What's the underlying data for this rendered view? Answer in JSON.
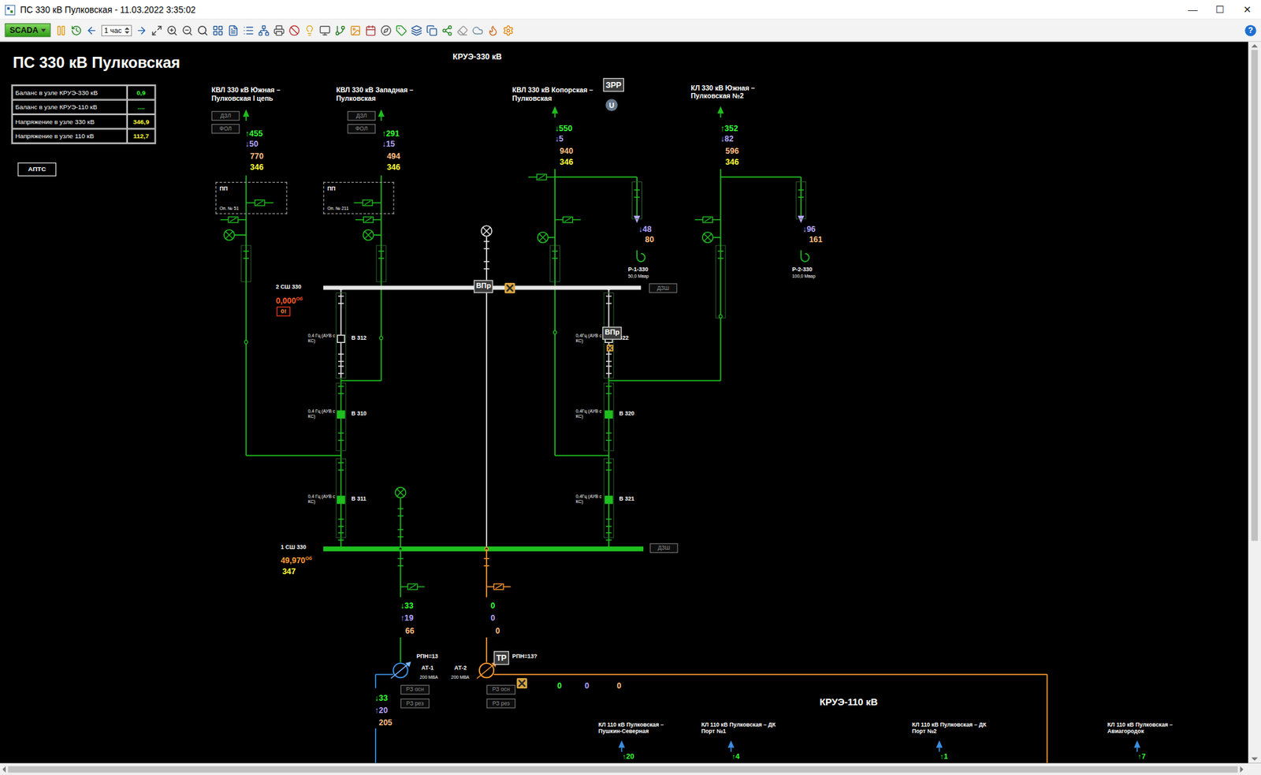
{
  "window": {
    "title": "ПС 330 кВ Пулковская - 11.03.2022 3:35:02",
    "controls": [
      "—",
      "☐",
      "✕"
    ]
  },
  "toolbar": {
    "mode": "SCADA",
    "interval": "1 час",
    "help": "?"
  },
  "header": {
    "title": "ПС 330 кВ Пулковская",
    "section_330": "КРУЭ-330 кВ",
    "section_110": "КРУЭ-110 кВ"
  },
  "info_table": [
    {
      "label": "Баланс в узле КРУЭ-330 кВ",
      "value": "0,9",
      "color": "#33ff33"
    },
    {
      "label": "Баланс в узле КРУЭ-110 кВ",
      "value": "....",
      "color": "#33ff33"
    },
    {
      "label": "Напряжение в узле 330 кВ",
      "value": "346,9",
      "color": "#ffff33"
    },
    {
      "label": "Напряжение в узле 110 кВ",
      "value": "112,7",
      "color": "#ffff33"
    }
  ],
  "aptc_button": "АПТС",
  "feeders_330": [
    {
      "name": "КВЛ 330 кВ Южная – Пулковская I цепь",
      "badges": [
        {
          "label": "ДЗЛ",
          "disabled": true
        },
        {
          "label": "ФОЛ",
          "disabled": true
        }
      ],
      "tags": [],
      "p": "↑455",
      "q": "↓50",
      "i": "770",
      "u": "346",
      "pp": {
        "label": "ПП",
        "support": "Оп. № 51"
      }
    },
    {
      "name": "КВЛ 330 кВ Западная – Пулковская",
      "badges": [
        {
          "label": "ДЗЛ",
          "disabled": true
        },
        {
          "label": "ФОЛ",
          "disabled": true
        }
      ],
      "tags": [],
      "p": "↑291",
      "q": "↓15",
      "i": "494",
      "u": "346",
      "pp": {
        "label": "ПП",
        "support": "Оп. № 211"
      }
    },
    {
      "name": "КВЛ 330 кВ Копорская – Пулковская",
      "badges": [],
      "tags": [
        {
          "label": "ЗРР",
          "kind": "box"
        },
        {
          "label": "U",
          "kind": "circle"
        }
      ],
      "p": "↓550",
      "q": "↓5",
      "i": "940",
      "u": "346",
      "reactor": {
        "q": "↓48",
        "i": "80",
        "name": "Р-1-330",
        "rating": "50,0 Мвар"
      }
    },
    {
      "name": "КЛ 330 кВ Южная – Пулковская №2",
      "badges": [],
      "tags": [],
      "p": "↑352",
      "q": "↓82",
      "i": "596",
      "u": "346",
      "reactor": {
        "q": "↓96",
        "i": "161",
        "name": "Р-2-330",
        "rating": "100,0 Мвар"
      }
    }
  ],
  "buses": [
    {
      "name": "2 СШ 330",
      "reading": "0,000",
      "unit": "Об",
      "alarm": "0!",
      "voltage": "",
      "energized": false,
      "protection": {
        "label": "ДЗШ",
        "disabled": true
      }
    },
    {
      "name": "1 СШ 330",
      "reading": "49,970",
      "unit": "Об",
      "alarm": "",
      "voltage": "347",
      "energized": true,
      "protection": {
        "label": "ДЗШ",
        "disabled": true
      }
    }
  ],
  "coupler": {
    "marker": "ВПр"
  },
  "breakers": [
    {
      "name": "В 312",
      "note": "0,4 Гц (АУВ с КС)",
      "closed": false,
      "marker": ""
    },
    {
      "name": "В 310",
      "note": "0,4 Гц (АУВ с КС)",
      "closed": true,
      "marker": ""
    },
    {
      "name": "В 311",
      "note": "0,4 Гц (АУВ с КС)",
      "closed": true,
      "marker": ""
    },
    {
      "name": "322",
      "note": "0,4Гц (АУВ с КС)",
      "closed": false,
      "marker": "ВПр"
    },
    {
      "name": "В 320",
      "note": "0,4Гц (АУВ с КС)",
      "closed": true,
      "marker": ""
    },
    {
      "name": "В 321",
      "note": "0,4Гц (АУВ с КС)",
      "closed": true,
      "marker": ""
    }
  ],
  "transformers": [
    {
      "name": "АТ-1",
      "rating": "200 МВА",
      "tap": "РПН=13",
      "marker": "",
      "energized": true,
      "hv": {
        "p": "↓33",
        "q": "↑19",
        "i": "66"
      },
      "mv": {
        "p": "↓33",
        "q": "↑20",
        "i": "205"
      },
      "protections": [
        {
          "label": "РЗ осн",
          "disabled": true
        },
        {
          "label": "РЗ рез",
          "disabled": true
        }
      ]
    },
    {
      "name": "АТ-2",
      "rating": "200 МВА",
      "tap": "РПН=13?",
      "marker": "ТР",
      "energized": false,
      "hv": {
        "p": "0",
        "q": "0",
        "i": "0"
      },
      "mv": {
        "p": "0",
        "q": "0",
        "i": "0"
      },
      "protections": [
        {
          "label": "РЗ осн",
          "disabled": true
        },
        {
          "label": "РЗ рез",
          "disabled": true
        }
      ]
    }
  ],
  "feeders_110": [
    {
      "name": "КЛ 110 кВ Пулковская – Пушкин-Северная",
      "p": "↑20"
    },
    {
      "name": "КЛ 110 кВ Пулковская – ДК Порт №1",
      "p": "↑4"
    },
    {
      "name": "КЛ 110 кВ Пулковская – ДК Порт №2",
      "p": "↑1"
    },
    {
      "name": "КЛ 110 кВ Пулковская – Авиагородок",
      "p": "↑7"
    }
  ]
}
